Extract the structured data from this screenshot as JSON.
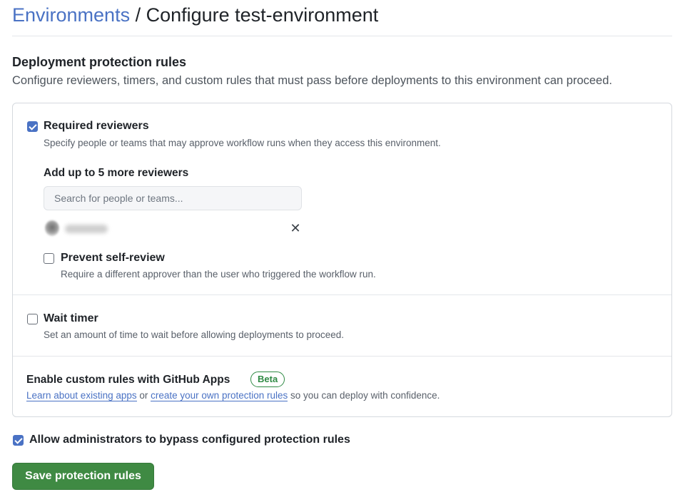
{
  "header": {
    "breadcrumb_link": "Environments",
    "separator": " / ",
    "title": "Configure test-environment"
  },
  "section": {
    "title": "Deployment protection rules",
    "description": "Configure reviewers, timers, and custom rules that must pass before deployments to this environment can proceed."
  },
  "required_reviewers": {
    "checked": true,
    "label": "Required reviewers",
    "description": "Specify people or teams that may approve workflow runs when they access this environment.",
    "add_label": "Add up to 5 more reviewers",
    "search_placeholder": "Search for people or teams...",
    "remove_glyph": "✕",
    "prevent_self_review": {
      "checked": false,
      "label": "Prevent self-review",
      "description": "Require a different approver than the user who triggered the workflow run."
    }
  },
  "wait_timer": {
    "checked": false,
    "label": "Wait timer",
    "description": "Set an amount of time to wait before allowing deployments to proceed."
  },
  "custom_rules": {
    "title": "Enable custom rules with GitHub Apps",
    "badge": "Beta",
    "link1": "Learn about existing apps",
    "middle": " or ",
    "link2": "create your own protection rules",
    "suffix": " so you can deploy with confidence."
  },
  "admin_bypass": {
    "checked": true,
    "label": "Allow administrators to bypass configured protection rules"
  },
  "save_button": "Save protection rules",
  "colors": {
    "link": "#4a72c4",
    "checkbox_checked": "#4a72c4",
    "save_button": "#3f8a43",
    "beta_badge": "#2f8a44"
  }
}
